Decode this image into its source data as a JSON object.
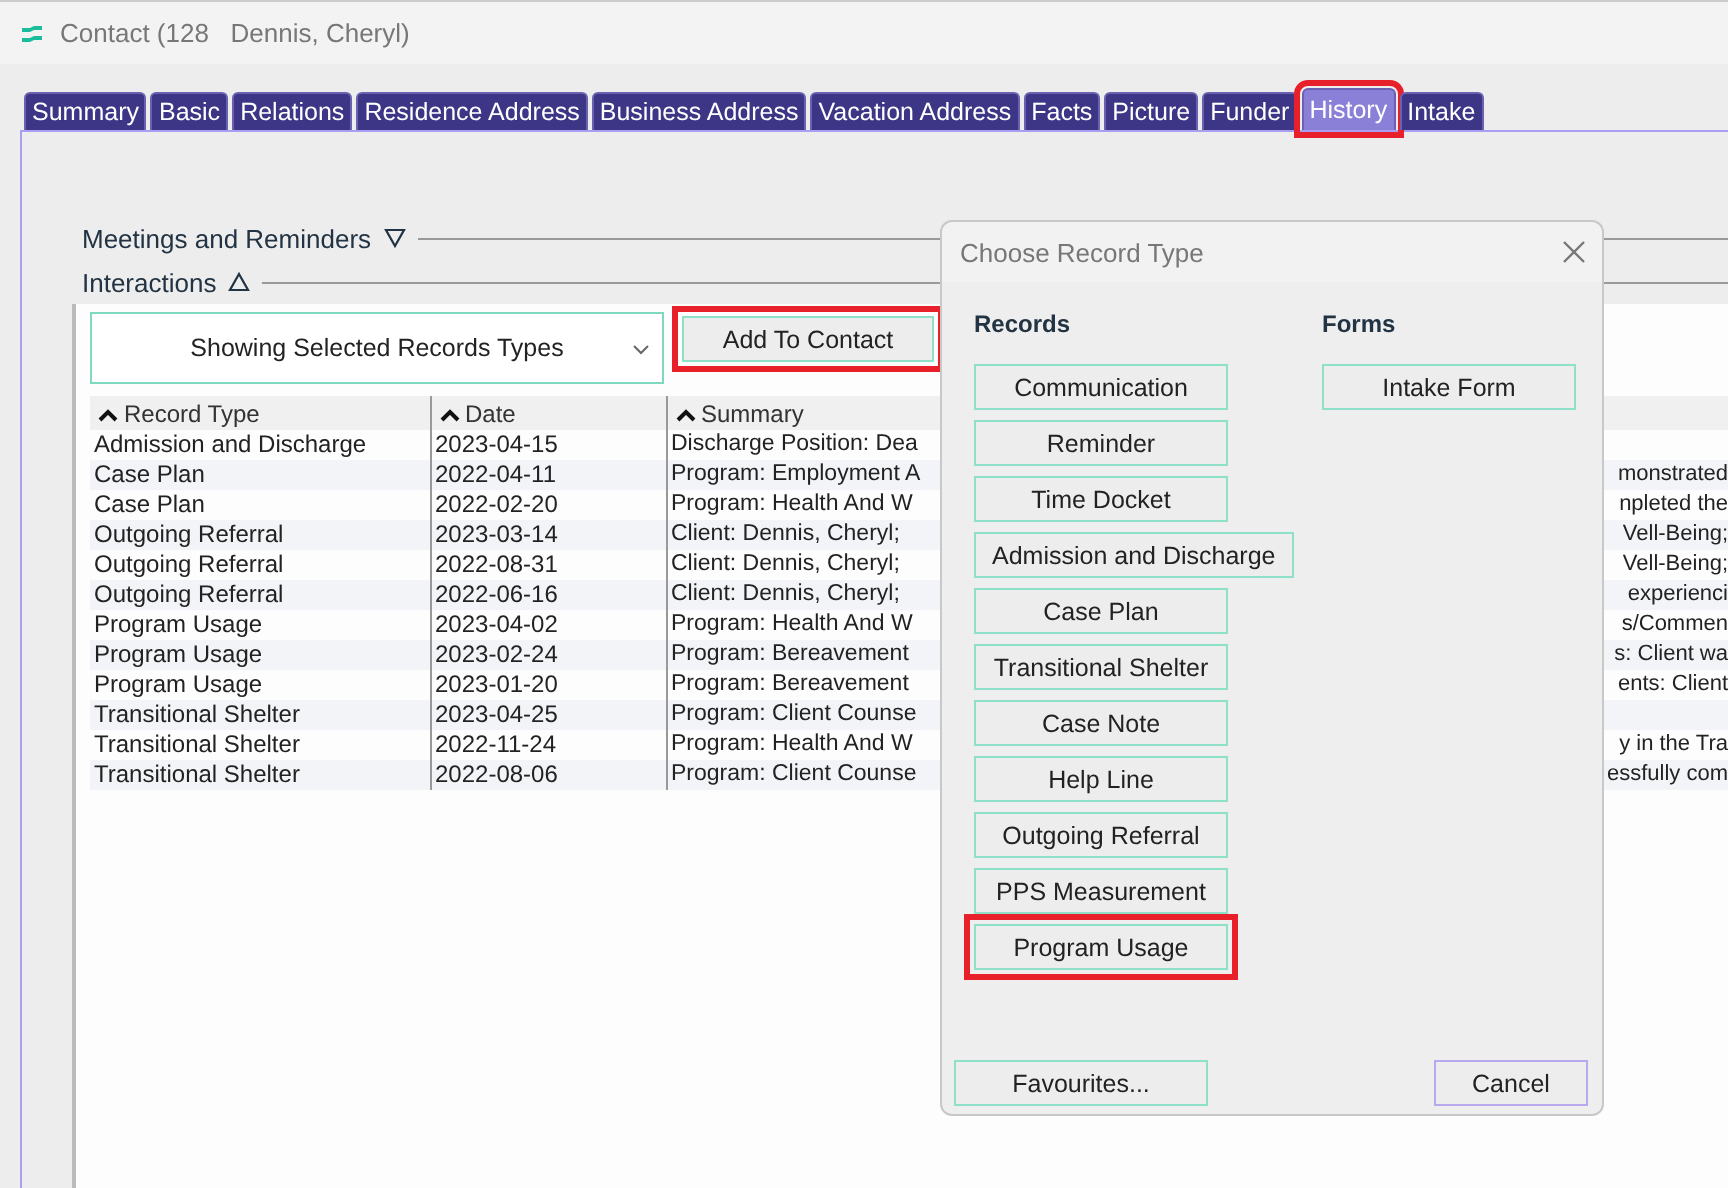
{
  "window": {
    "title": "Contact (128   Dennis, Cheryl)"
  },
  "tabs": [
    {
      "label": "Summary",
      "selected": false,
      "highlighted": false
    },
    {
      "label": "Basic",
      "selected": false,
      "highlighted": false
    },
    {
      "label": "Relations",
      "selected": false,
      "highlighted": false
    },
    {
      "label": "Residence Address",
      "selected": false,
      "highlighted": false
    },
    {
      "label": "Business Address",
      "selected": false,
      "highlighted": false
    },
    {
      "label": "Vacation Address",
      "selected": false,
      "highlighted": false
    },
    {
      "label": "Facts",
      "selected": false,
      "highlighted": false
    },
    {
      "label": "Picture",
      "selected": false,
      "highlighted": false
    },
    {
      "label": "Funder",
      "selected": false,
      "highlighted": false
    },
    {
      "label": "History",
      "selected": true,
      "highlighted": true
    },
    {
      "label": "Intake",
      "selected": false,
      "highlighted": false
    }
  ],
  "sections": [
    {
      "label": "Meetings and Reminders",
      "expanded": false
    },
    {
      "label": "Interactions",
      "expanded": true
    }
  ],
  "filter": {
    "value": "Showing Selected Records Types"
  },
  "add_button": {
    "label": "Add To Contact",
    "highlighted": true
  },
  "table": {
    "columns": [
      "Record Type",
      "Date",
      "Summary"
    ],
    "rows": [
      {
        "record_type": "Admission and Discharge",
        "date": "2023-04-15",
        "summary_start": "Discharge Position: Dea",
        "summary_end": ""
      },
      {
        "record_type": "Case Plan",
        "date": "2022-04-11",
        "summary_start": "Program: Employment A",
        "summary_end": "monstrated"
      },
      {
        "record_type": "Case Plan",
        "date": "2022-02-20",
        "summary_start": "Program: Health And W",
        "summary_end": "npleted the"
      },
      {
        "record_type": "Outgoing Referral",
        "date": "2023-03-14",
        "summary_start": "Client: Dennis, Cheryl;",
        "summary_end": "Vell-Being;"
      },
      {
        "record_type": "Outgoing Referral",
        "date": "2022-08-31",
        "summary_start": "Client: Dennis, Cheryl;",
        "summary_end": "Vell-Being;"
      },
      {
        "record_type": "Outgoing Referral",
        "date": "2022-06-16",
        "summary_start": "Client: Dennis, Cheryl;",
        "summary_end": "experienci"
      },
      {
        "record_type": "Program Usage",
        "date": "2023-04-02",
        "summary_start": "Program: Health And W",
        "summary_end": "s/Commen"
      },
      {
        "record_type": "Program Usage",
        "date": "2023-02-24",
        "summary_start": "Program: Bereavement",
        "summary_end": "s: Client wa"
      },
      {
        "record_type": "Program Usage",
        "date": "2023-01-20",
        "summary_start": "Program: Bereavement",
        "summary_end": "ents: Client"
      },
      {
        "record_type": "Transitional Shelter",
        "date": "2023-04-25",
        "summary_start": "Program: Client Counse",
        "summary_end": ""
      },
      {
        "record_type": "Transitional Shelter",
        "date": "2022-11-24",
        "summary_start": "Program: Health And W",
        "summary_end": "y in the Tra"
      },
      {
        "record_type": "Transitional Shelter",
        "date": "2022-08-06",
        "summary_start": "Program: Client Counse",
        "summary_end": "essfully com"
      }
    ]
  },
  "dialog": {
    "title": "Choose Record Type",
    "records_heading": "Records",
    "records": [
      {
        "label": "Communication",
        "highlighted": false
      },
      {
        "label": "Reminder",
        "highlighted": false
      },
      {
        "label": "Time Docket",
        "highlighted": false
      },
      {
        "label": "Admission and Discharge",
        "highlighted": false
      },
      {
        "label": "Case Plan",
        "highlighted": false
      },
      {
        "label": "Transitional Shelter",
        "highlighted": false
      },
      {
        "label": "Case Note",
        "highlighted": false
      },
      {
        "label": "Help Line",
        "highlighted": false
      },
      {
        "label": "Outgoing Referral",
        "highlighted": false
      },
      {
        "label": "PPS Measurement",
        "highlighted": false
      },
      {
        "label": "Program Usage",
        "highlighted": true
      }
    ],
    "forms_heading": "Forms",
    "forms": [
      {
        "label": "Intake Form",
        "highlighted": false
      }
    ],
    "buttons": [
      {
        "label": "Favourites...",
        "kind": "secondary"
      },
      {
        "label": "Cancel",
        "kind": "cancel"
      }
    ]
  }
}
